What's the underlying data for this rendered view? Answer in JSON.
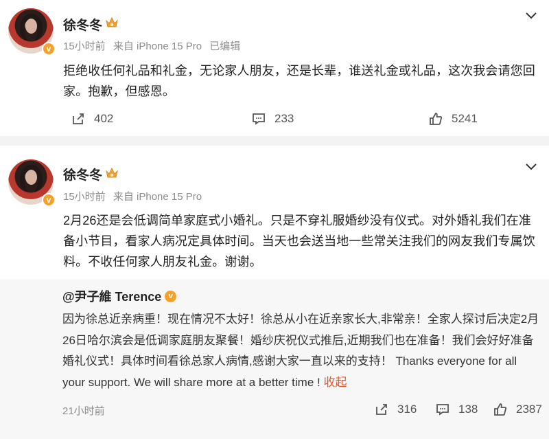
{
  "posts": [
    {
      "author": "徐冬冬",
      "time": "15小时前",
      "source": "来自 iPhone 15 Pro",
      "edited": "已编辑",
      "content": "拒绝收任何礼品和礼金，无论家人朋友，还是长辈，谁送礼金或礼品，这次我会请您回家。抱歉，但感恩。",
      "reposts": "402",
      "comments": "233",
      "likes": "5241"
    },
    {
      "author": "徐冬冬",
      "time": "15小时前",
      "source": "来自 iPhone 15 Pro",
      "content": "2月26还是会低调简单家庭式小婚礼。只是不穿礼服婚纱没有仪式。对外婚礼我们在准备小节目，看家人病况定具体时间。当天也会送当地一些常关注我们的网友我们专属饮料。不收任何家人朋友礼金。谢谢。",
      "quoted": {
        "author": "@尹子維 Terence",
        "text": "因为徐总近亲病重！现在情况不太好！徐总从小在近亲家长大,非常亲！全家人探讨后决定2月26日哈尔滨会是低调家庭朋友聚餐！婚纱庆祝仪式推后,近期我们也在准备！我们会好好准备婚礼仪式！具体时间看徐总家人病情,感谢大家一直以来的支持！ Thanks everyone for all your support.  We will share more at a better time ! ",
        "collapse_label": "收起",
        "time": "21小时前",
        "reposts": "316",
        "comments": "138",
        "likes": "2387"
      }
    }
  ],
  "colors": {
    "accent": "#e4572e",
    "verified": "#f7a12a"
  },
  "icons": [
    "verified-badge-icon",
    "crown-icon",
    "chevron-down-icon",
    "repost-icon",
    "comment-icon",
    "like-icon"
  ]
}
